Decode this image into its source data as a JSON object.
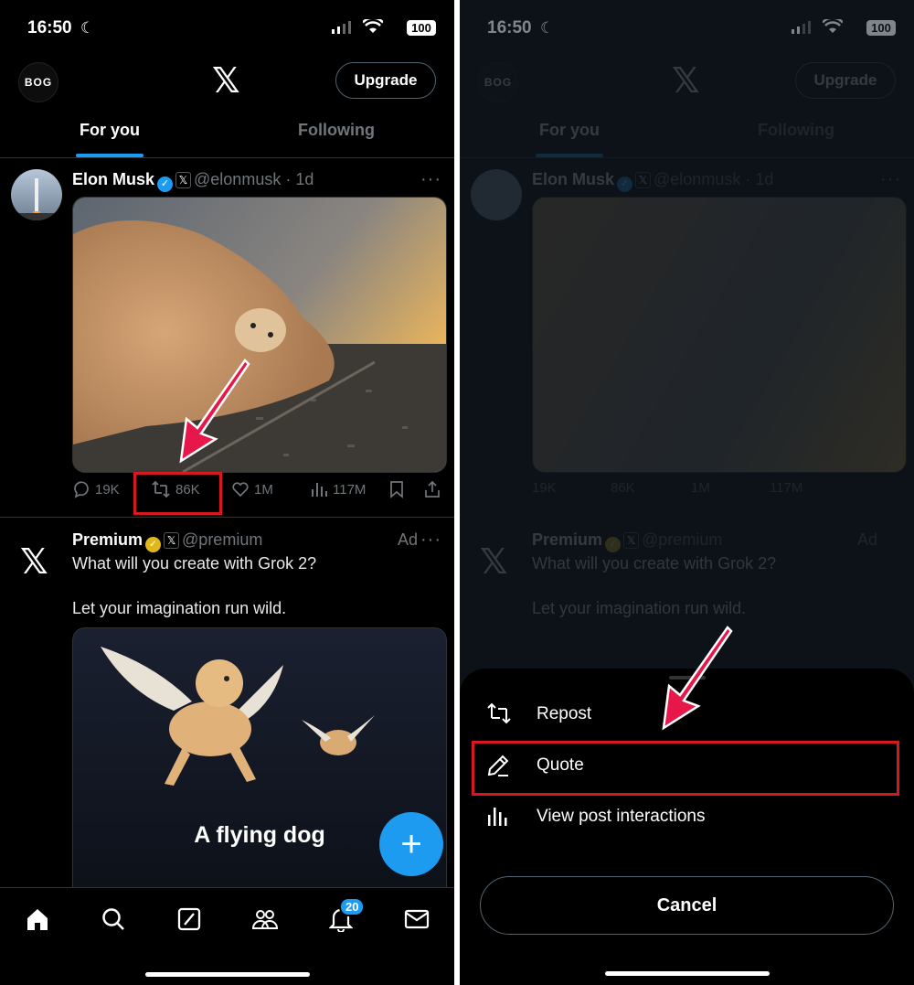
{
  "status": {
    "time": "16:50",
    "battery": "100"
  },
  "header": {
    "logo_text": "BOG",
    "logo_accent": "G",
    "x_logo": "𝕏",
    "upgrade_label": "Upgrade"
  },
  "tabs": [
    {
      "label": "For you",
      "active": true
    },
    {
      "label": "Following",
      "active": false
    }
  ],
  "post1": {
    "name": "Elon Musk",
    "handle": "@elonmusk · 1d",
    "more": "···",
    "media_description_color": "#c79a6a",
    "actions": {
      "replies": "19K",
      "reposts": "86K",
      "likes": "1M",
      "views": "117M"
    }
  },
  "post2": {
    "name": "Premium",
    "handle": "@premium",
    "ad_label": "Ad",
    "more": "···",
    "line1": "What will you create with Grok 2?",
    "line2": "Let your imagination run wild.",
    "media_caption": "A flying dog"
  },
  "fab_label": "+",
  "nav": {
    "notifications_badge": "20"
  },
  "sheet": {
    "items": [
      {
        "label": "Repost",
        "icon": "repost-icon"
      },
      {
        "label": "Quote",
        "icon": "pencil-icon"
      },
      {
        "label": "View post interactions",
        "icon": "bar-chart-icon"
      }
    ],
    "cancel_label": "Cancel"
  },
  "colors": {
    "accent": "#1d9bf0",
    "highlight": "#d71820",
    "arrow": "#e8174a",
    "gold": "#e2b719"
  }
}
